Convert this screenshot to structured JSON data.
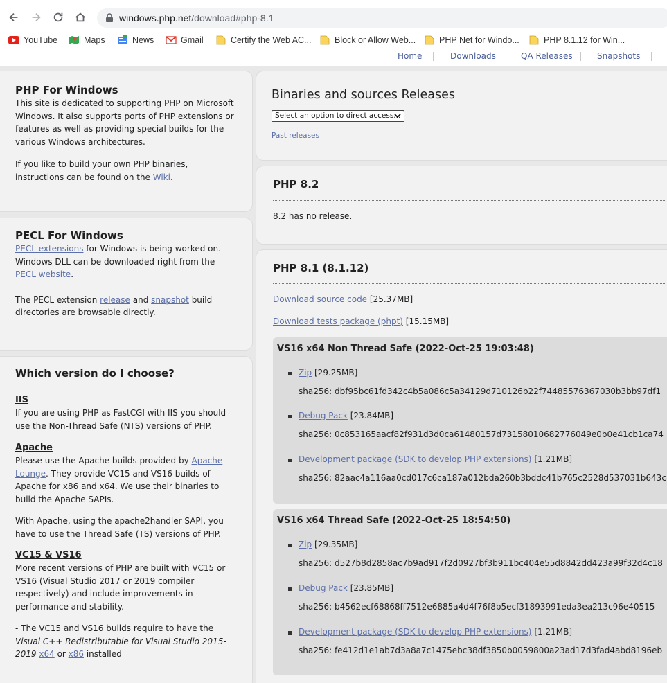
{
  "browser": {
    "url_host": "windows.php.net",
    "url_path": "/download#php-8.1",
    "bookmarks": [
      {
        "label": "YouTube"
      },
      {
        "label": "Maps"
      },
      {
        "label": "News"
      },
      {
        "label": "Gmail"
      },
      {
        "label": "Certify the Web AC..."
      },
      {
        "label": "Block or Allow Web..."
      },
      {
        "label": "PHP Net for Windo..."
      },
      {
        "label": "PHP 8.1.12 for Win..."
      }
    ]
  },
  "topnav": [
    "Home",
    "Downloads",
    "QA Releases",
    "Snapshots"
  ],
  "sidebar": {
    "php_windows": {
      "title": "PHP For Windows",
      "p1": "This site is dedicated to supporting PHP on Microsoft Windows. It also supports ports of PHP extensions or features as well as providing special builds for the various Windows architectures.",
      "p2_pre": "If you like to build your own PHP binaries, instructions can be found on the ",
      "p2_link": "Wiki",
      "p2_post": "."
    },
    "pecl": {
      "title": "PECL For Windows",
      "link1": "PECL extensions",
      "t1": " for Windows is being worked on. Windows DLL can be downloaded right from the ",
      "link2": "PECL website",
      "t2": ".",
      "t3": "The PECL extension ",
      "link3": "release",
      "t4": " and ",
      "link4": "snapshot",
      "t5": " build directories are browsable directly."
    },
    "choose": {
      "title": "Which version do I choose?",
      "iis_h": "IIS",
      "iis_p": "If you are using PHP as FastCGI with IIS you should use the Non-Thread Safe (NTS) versions of PHP.",
      "apache_h": "Apache",
      "apache_p1": "Please use the Apache builds provided by ",
      "apache_link": "Apache Lounge",
      "apache_p2": ". They provide VC15 and VS16 builds of Apache for x86 and x64. We use their binaries to build the Apache SAPIs.",
      "apache_p3": "With Apache, using the apache2handler SAPI, you have to use the Thread Safe (TS) versions of PHP.",
      "vc_h": "VC15 & VS16",
      "vc_p": "More recent versions of PHP are built with VC15 or VS16 (Visual Studio 2017 or 2019 compiler respectively) and include improvements in performance and stability.",
      "vc_p2a": "- The VC15 and VS16 builds require to have the ",
      "vc_p2em": "Visual C++ Redistributable for Visual Studio 2015-2019",
      "vc_p2b": " ",
      "vc_link1": "x64",
      "vc_p2c": " or ",
      "vc_link2": "x86",
      "vc_p2d": " installed"
    }
  },
  "main": {
    "releases_title": "Binaries and sources Releases",
    "select_value": "Select an option to direct access...",
    "past_releases": "Past releases",
    "php82": {
      "title": "PHP 8.2",
      "note": "8.2 has no release."
    },
    "php81": {
      "title": "PHP 8.1 (8.1.12)",
      "source_link": "Download source code",
      "source_size": "[25.37MB]",
      "tests_link": "Download tests package (phpt)",
      "tests_size": "[15.15MB]",
      "builds": [
        {
          "title": "VS16 x64 Non Thread Safe (2022-Oct-25 19:03:48)",
          "items": [
            {
              "link": "Zip",
              "size": "[29.25MB]",
              "sha": "sha256: dbf95bc61fd342c4b5a086c5a34129d710126b22f74485576367030b3bb97df1"
            },
            {
              "link": "Debug Pack",
              "size": "[23.84MB]",
              "sha": "sha256: 0c853165aacf82f931d3d0ca61480157d73158010682776049e0b0e41cb1ca74"
            },
            {
              "link": "Development package (SDK to develop PHP extensions)",
              "size": "[1.21MB]",
              "sha": "sha256: 82aac4a116aa0cd017c6ca187a012bda260b3bddc41b765c2528d537031b643c"
            }
          ]
        },
        {
          "title": "VS16 x64 Thread Safe (2022-Oct-25 18:54:50)",
          "items": [
            {
              "link": "Zip",
              "size": "[29.35MB]",
              "sha": "sha256: d527b8d2858ac7b9ad917f2d0927bf3b911bc404e55d8842dd423a99f32d4c18"
            },
            {
              "link": "Debug Pack",
              "size": "[23.85MB]",
              "sha": "sha256: b4562ecf68868ff7512e6885a4d4f76f8b5ecf31893991eda3ea213c96e40515"
            },
            {
              "link": "Development package (SDK to develop PHP extensions)",
              "size": "[1.21MB]",
              "sha": "sha256: fe412d1e1ab7d3a8a7c1475ebc38df3850b0059800a23ad17d3fad4abd8196eb"
            }
          ]
        }
      ]
    }
  }
}
